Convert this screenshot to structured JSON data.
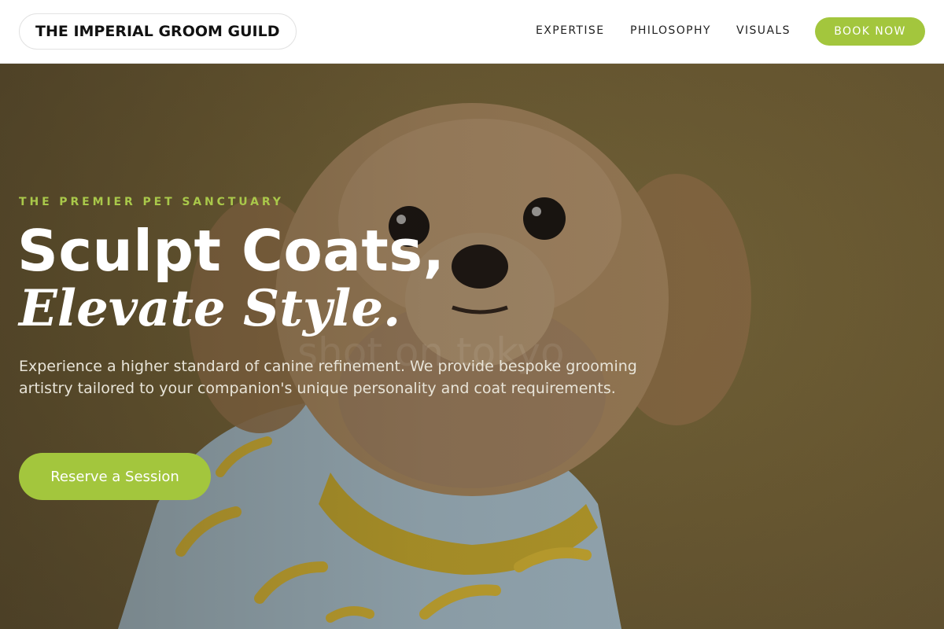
{
  "header": {
    "logo_text": "THE IMPERIAL GROOM GUILD",
    "nav": [
      {
        "label": "EXPERTISE"
      },
      {
        "label": "PHILOSOPHY"
      },
      {
        "label": "VISUALS"
      }
    ],
    "cta_label": "BOOK NOW"
  },
  "hero": {
    "eyebrow": "THE PREMIER PET SANCTUARY",
    "headline_line1": "Sculpt Coats,",
    "headline_line2": "Elevate Style.",
    "description": "Experience a higher standard of canine refinement. We provide bespoke grooming artistry tailored to your companion's unique personality and coat requirements.",
    "cta_label": "Reserve a Session",
    "image_subject": "fluffy dog wearing banana-print shirt",
    "watermark": "shot on tokyo"
  },
  "colors": {
    "accent": "#a3c63d",
    "eyebrow": "#a9c84a",
    "header_bg": "#ffffff",
    "hero_bg": "#6c5b33"
  }
}
